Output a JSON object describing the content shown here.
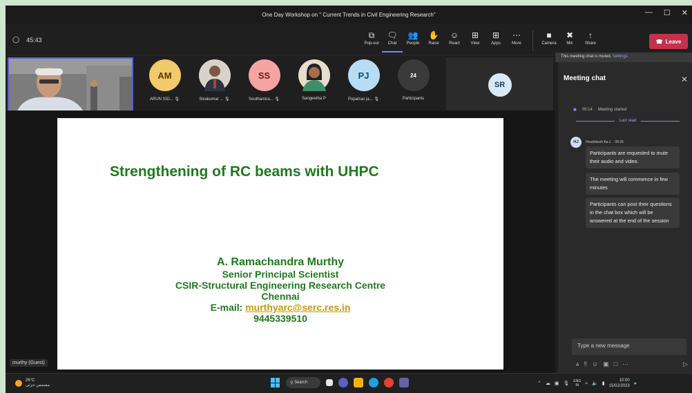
{
  "window": {
    "title": "One Day Workshop on \" Current Trends in Civil Engineering Research\"",
    "minimize": "—",
    "maximize": "☐",
    "close": "✕"
  },
  "meeting": {
    "elapsed": "45:43"
  },
  "toolbar": {
    "items": [
      {
        "label": "Pop-out",
        "icon": "⧉"
      },
      {
        "label": "Chat",
        "icon": "🗨"
      },
      {
        "label": "People",
        "icon": "👥"
      },
      {
        "label": "Raise",
        "icon": "✋"
      },
      {
        "label": "React",
        "icon": "☺"
      },
      {
        "label": "View",
        "icon": "⊞"
      },
      {
        "label": "Apps",
        "icon": "⊞"
      },
      {
        "label": "More",
        "icon": "⋯"
      }
    ],
    "devices": [
      {
        "label": "Camera",
        "icon": "■"
      },
      {
        "label": "Mic",
        "icon": "✖"
      },
      {
        "label": "Share",
        "icon": "↑"
      }
    ],
    "leave_label": "Leave"
  },
  "participants": [
    {
      "initials": "AM",
      "name": "ARUN SID...",
      "bg": "#f2c96b",
      "fg": "#5a3b00"
    },
    {
      "initials": "",
      "name": "Sivakumar ...",
      "bg": "#8a7b6c",
      "fg": "#fff"
    },
    {
      "initials": "SS",
      "name": "Southamira...",
      "bg": "#f5a3a3",
      "fg": "#6b1d1d"
    },
    {
      "initials": "",
      "name": "Sangeetha P",
      "bg": "#b88f6a",
      "fg": "#fff"
    },
    {
      "initials": "PJ",
      "name": "Popatrao ja...",
      "bg": "#b9dcf5",
      "fg": "#0b4a7a"
    },
    {
      "initials": "24",
      "name": "Participants",
      "bg": "#3a3a3a",
      "fg": "#fff"
    }
  ],
  "featured": {
    "initials": "SR"
  },
  "slide": {
    "title": "Strengthening of RC beams with UHPC",
    "author": "A.   Ramachandra Murthy",
    "role": "Senior Principal Scientist",
    "org": "CSIR-Structural Engineering Research Centre",
    "city": "Chennai",
    "email_label": "E-mail: ",
    "email": "murthyarc@serc.res.in",
    "phone": "9445339510"
  },
  "self_label": "murthy (Guest)",
  "chat": {
    "muted_notice": "This meeting chat is muted. ",
    "settings_link": "Settings",
    "title": "Meeting chat",
    "started_time": "09:14",
    "started_text": "Meeting started",
    "last_read": "Last read",
    "author_initials": "HJ",
    "author": "Hrushikesh Ba J",
    "author_time": "09:26",
    "messages": [
      "Participants are requested to mute their audio and video.",
      "The meeting will commence in few minutes",
      "Participants can post their questions in the chat box which will be answered at the end of the session"
    ],
    "compose_placeholder": "Type a new message"
  },
  "taskbar": {
    "temp": "26°C",
    "weather": "مشمس جزئي",
    "search": "Search",
    "lang1": "ENG",
    "lang2": "IN",
    "time": "10:00",
    "date": "15/02/2023"
  }
}
